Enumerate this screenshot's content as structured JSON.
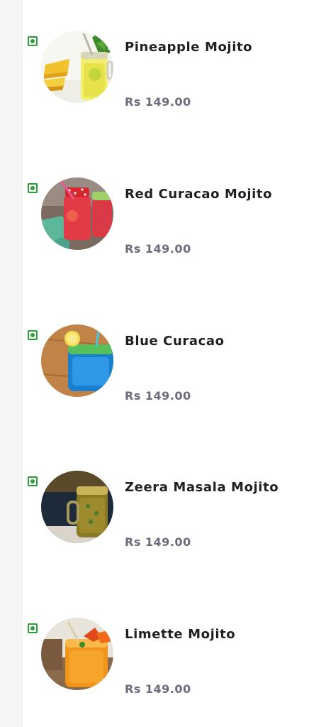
{
  "menu": {
    "items": [
      {
        "name": "Pineapple Mojito",
        "price": "Rs 149.00",
        "diet_icon": "veg-indicator-icon",
        "image": "pineapple-mojito-photo"
      },
      {
        "name": "Red Curacao Mojito",
        "price": "Rs 149.00",
        "diet_icon": "veg-indicator-icon",
        "image": "red-curacao-mojito-photo"
      },
      {
        "name": "Blue Curacao",
        "price": "Rs 149.00",
        "diet_icon": "veg-indicator-icon",
        "image": "blue-curacao-photo"
      },
      {
        "name": "Zeera Masala Mojito",
        "price": "Rs 149.00",
        "diet_icon": "veg-indicator-icon",
        "image": "zeera-masala-mojito-photo"
      },
      {
        "name": "Limette Mojito",
        "price": "Rs 149.00",
        "diet_icon": "veg-indicator-icon",
        "image": "limette-mojito-photo"
      }
    ]
  },
  "colors": {
    "veg_green": "#2e9e3a",
    "name_text": "#1f1f24",
    "price_text": "#6b6b7d",
    "rail": "#f5f5f6"
  }
}
